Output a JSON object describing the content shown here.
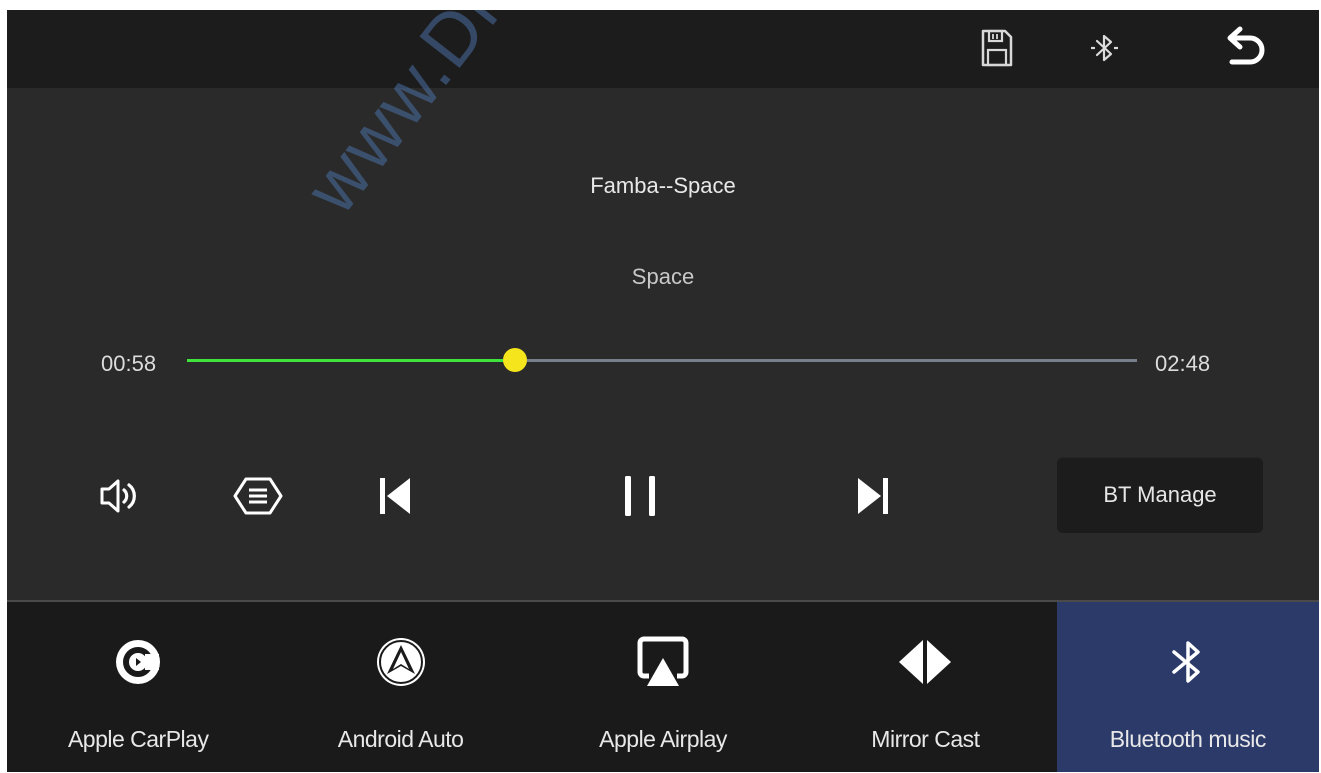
{
  "top_bar": {
    "icons": [
      "save-icon",
      "bluetooth-icon",
      "back-arrow-icon"
    ]
  },
  "watermark": "www.Drivetc",
  "track": {
    "title": "Famba--Space",
    "album": "Space",
    "elapsed": "00:58",
    "total": "02:48",
    "progress": 0.345
  },
  "controls": {
    "icons": [
      "volume-icon",
      "equalizer-icon",
      "previous-track-icon",
      "pause-icon",
      "next-track-icon"
    ],
    "bt_manage_label": "BT Manage"
  },
  "bottom_nav": {
    "items": [
      {
        "label": "Apple CarPlay",
        "icon": "carplay-icon",
        "active": false
      },
      {
        "label": "Android Auto",
        "icon": "android-auto-icon",
        "active": false
      },
      {
        "label": "Apple Airplay",
        "icon": "airplay-icon",
        "active": false
      },
      {
        "label": "Mirror Cast",
        "icon": "mirror-cast-icon",
        "active": false
      },
      {
        "label": "Bluetooth music",
        "icon": "bluetooth-icon",
        "active": true
      }
    ]
  },
  "colors": {
    "progress_fill": "#3fe33c",
    "progress_thumb": "#f5e51c",
    "active_tab": "#2c3a6a",
    "background": "#2a2a2a"
  }
}
